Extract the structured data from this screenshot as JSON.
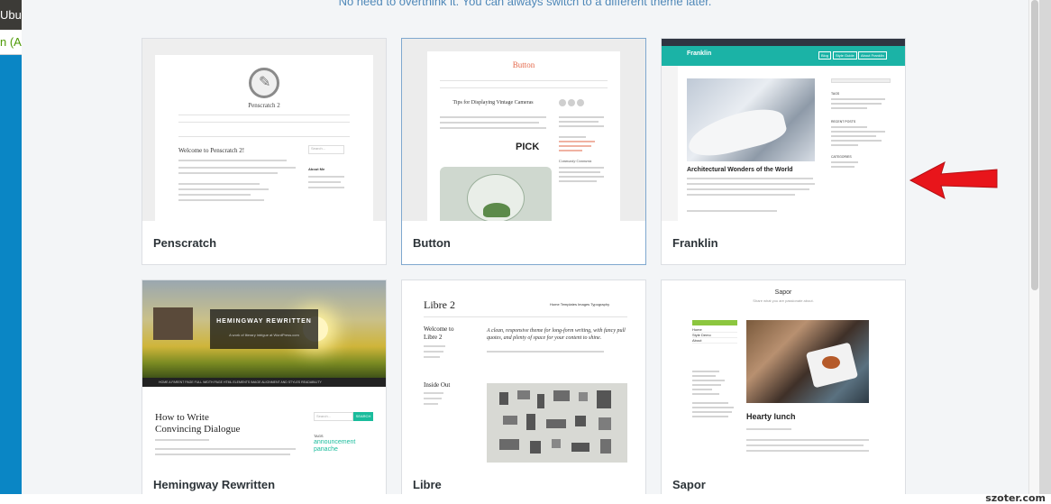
{
  "left_window": {
    "title_fragment": "Ubur",
    "tab_fragment": "n (Au"
  },
  "page": {
    "hint": "No need to overthink it. You can always switch to a different theme later."
  },
  "themes": [
    {
      "name": "Penscratch",
      "preview": {
        "site_title": "Penscratch 2",
        "post_title": "Welcome to Penscratch 2!",
        "search": "Search...",
        "widget_title": "About Me"
      }
    },
    {
      "name": "Button",
      "preview": {
        "site_title": "Button",
        "post_title": "Tips for Displaying Vintage Cameras",
        "overlay": "PICK",
        "widget_title": "Community Comments"
      }
    },
    {
      "name": "Franklin",
      "preview": {
        "site_title": "Franklin",
        "buttons": [
          "Blog",
          "Style Guide",
          "About Franklin"
        ],
        "headline": "Architectural Wonders of the World",
        "sidebar_headings": [
          "TAGS",
          "RECENT POSTS",
          "CATEGORIES"
        ]
      }
    },
    {
      "name": "Hemingway Rewritten",
      "preview": {
        "site_title": "HEMINGWAY REWRITTEN",
        "tagline": "A work of literary intrigue at WordPress.com",
        "nav": "HOME   A PARENT PAGE   FULL WIDTH PAGE   HTML ELEMENTS   IMAGE ALIGNMENT AND STYLES   READABILITY",
        "post_title": "How to Write Convincing Dialogue",
        "search": "Search...",
        "search_button": "SEARCH",
        "tags_title": "TAGS",
        "tags": "announcement panache"
      }
    },
    {
      "name": "Libre",
      "preview": {
        "site_title": "Libre 2",
        "nav": "Home   Templates   Images   Typography",
        "sidebar_post": "Welcome to Libre 2",
        "intro": "A clean, responsive theme for long-form writing, with fancy pull quotes, and plenty of space for your content to shine.",
        "second_post": "Inside Out"
      }
    },
    {
      "name": "Sapor",
      "preview": {
        "site_title": "Sapor",
        "tagline": "Share what you are passionate about.",
        "menu": [
          "Home",
          "Style Demo",
          "About"
        ],
        "post_title": "Hearty lunch"
      }
    }
  ],
  "colors": {
    "accent_blue": "#4f88b8",
    "arrow_red": "#e8151b",
    "franklin_teal": "#1bb3a6"
  },
  "watermark": "szoter.com"
}
